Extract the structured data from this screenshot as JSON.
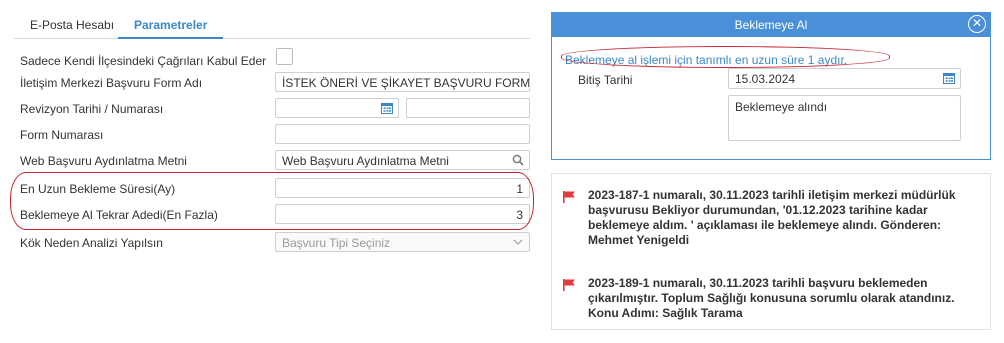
{
  "tabs": [
    {
      "label": "E-Posta Hesabı"
    },
    {
      "label": "Parametreler"
    }
  ],
  "form": {
    "rows": [
      {
        "label": "Sadece Kendi İlçesindeki Çağrıları Kabul Eder"
      },
      {
        "label": "İletişim Merkezi Başvuru Form Adı",
        "value": "İSTEK ÖNERİ VE ŞİKAYET BAŞVURU FORMU"
      },
      {
        "label": "Revizyon Tarihi / Numarası",
        "value": "",
        "value2": ""
      },
      {
        "label": "Form Numarası",
        "value": ""
      },
      {
        "label": "Web Başvuru Aydınlatma Metni",
        "value": "Web Başvuru Aydınlatma Metni"
      },
      {
        "label": "En Uzun Bekleme Süresi(Ay)",
        "value": "1"
      },
      {
        "label": "Beklemeye Al Tekrar Adedi(En Fazla)",
        "value": "3"
      },
      {
        "label": "Kök Neden Analizi Yapılsın",
        "placeholder": "Başvuru Tipi Seçiniz"
      }
    ]
  },
  "modal": {
    "title": "Beklemeye Al",
    "info": "Beklemeye al işlemi için tanımlı en uzun süre 1 aydır.",
    "end_date_label": "Bitiş Tarihi",
    "end_date": "15.03.2024",
    "note": "Beklemeye alındı"
  },
  "log": [
    {
      "text": "2023-187-1 numaralı, 30.11.2023 tarihli iletişim merkezi müdürlük başvurusu Bekliyor durumundan, '01.12.2023 tarihine kadar beklemeye aldım. ' açıklaması ile beklemeye alındı. Gönderen: Mehmet Yenigeldi"
    },
    {
      "text": "2023-189-1 numaralı, 30.11.2023 tarihli başvuru beklemeden çıkarılmıştır. Toplum Sağlığı konusuna sorumlu olarak atandınız. Konu Adımı: Sağlık Tarama"
    }
  ],
  "colors": {
    "accent": "#4a90d9",
    "annotation": "#c8262f",
    "flag": "#e03a3e"
  }
}
